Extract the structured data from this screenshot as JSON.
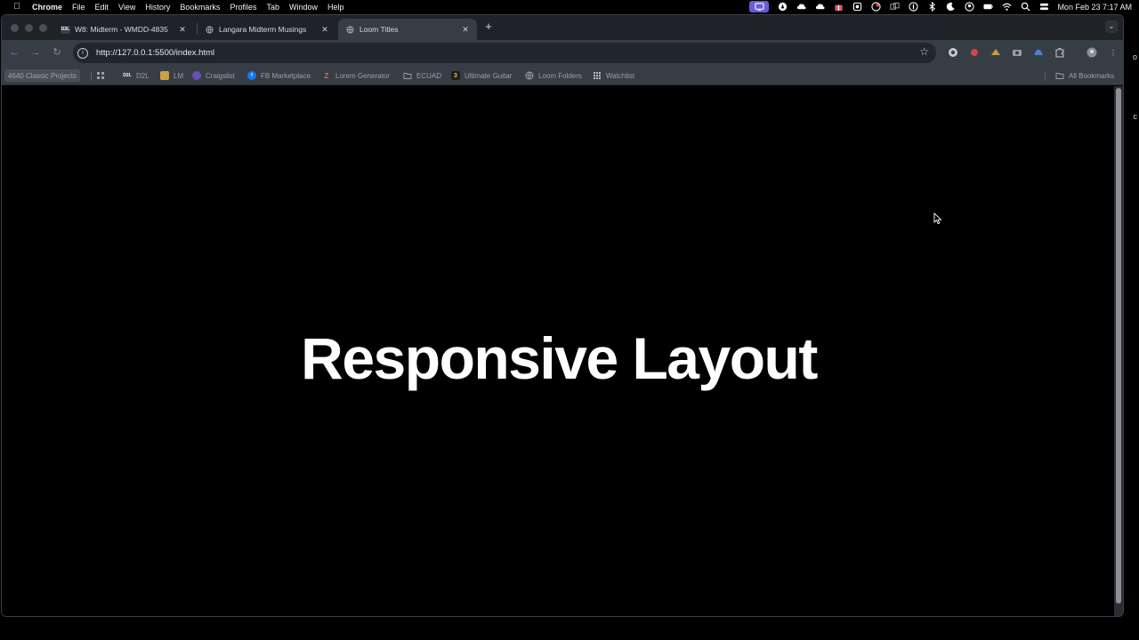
{
  "menubar": {
    "app_name": "Chrome",
    "items": [
      "File",
      "Edit",
      "View",
      "History",
      "Bookmarks",
      "Profiles",
      "Tab",
      "Window",
      "Help"
    ],
    "clock": "Mon Feb 23  7:17 AM"
  },
  "tabs": [
    {
      "favicon": "D2L",
      "title": "W8: Midterm - WMDD-4835",
      "active": false
    },
    {
      "favicon": "globe-icon",
      "title": "Langara Midterm Musings",
      "active": false
    },
    {
      "favicon": "globe-icon",
      "title": "Loom Titles",
      "active": true
    }
  ],
  "toolbar": {
    "url": "http://127.0.0.1:5500/index.html"
  },
  "bookmarks": [
    {
      "label": "4640 Classic Projects",
      "icon": "none"
    },
    {
      "label": "D2L",
      "icon": "d2l-icon"
    },
    {
      "label": "LM",
      "icon": "lm-icon"
    },
    {
      "label": "Craigslist",
      "icon": "craigslist-icon"
    },
    {
      "label": "FB Marketplace",
      "icon": "facebook-icon"
    },
    {
      "label": "Lorem Generator",
      "icon": "lorem-icon"
    },
    {
      "label": "ECUAD",
      "icon": "folder-icon"
    },
    {
      "label": "Ultimate Guitar",
      "icon": "ultimate-guitar-icon"
    },
    {
      "label": "Loom Folders",
      "icon": "globe-icon"
    },
    {
      "label": "Watchlist",
      "icon": "watchlist-icon"
    },
    {
      "label": "All Bookmarks",
      "icon": "folder-icon"
    }
  ],
  "page": {
    "heading": "Responsive Layout"
  },
  "edge": {
    "top_char": "o",
    "mid_char": "c"
  },
  "colors": {
    "page_background": "#000000",
    "heading": "#ffffff",
    "toolbar": "#373d44",
    "tabstrip": "#1f2328",
    "status_accent": "#6b5bd6"
  }
}
